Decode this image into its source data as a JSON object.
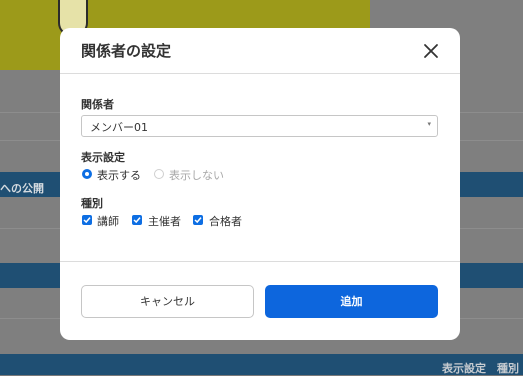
{
  "background": {
    "section_label": "への公開",
    "footer_columns": "表示設定　種別"
  },
  "modal": {
    "title": "関係者の設定",
    "related_person": {
      "label": "関係者",
      "selected": "メンバー01"
    },
    "display": {
      "label": "表示設定",
      "options": [
        {
          "label": "表示する",
          "selected": true
        },
        {
          "label": "表示しない",
          "selected": false
        }
      ]
    },
    "type": {
      "label": "種別",
      "options": [
        {
          "label": "講師",
          "checked": true
        },
        {
          "label": "主催者",
          "checked": true
        },
        {
          "label": "合格者",
          "checked": true
        }
      ]
    },
    "cancel_label": "キャンセル",
    "add_label": "追加"
  }
}
